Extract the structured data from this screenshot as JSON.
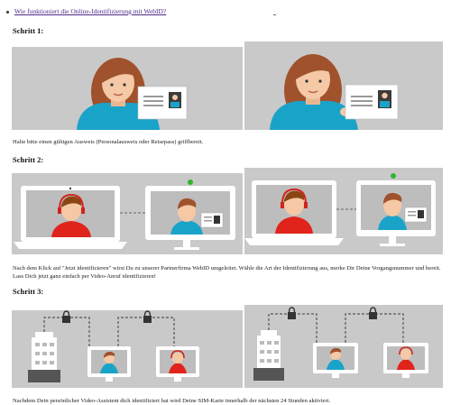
{
  "faq_link": "Wie funktioniert die Online-Identifizierung mit WebID?",
  "steps": [
    {
      "title": "Schritt 1:",
      "caption": "Halte bitte einen gültigen Ausweis (Personalausweis oder Reisepass) griffbereit."
    },
    {
      "title": "Schritt 2:",
      "caption": "Nach dem Klick auf \"Jetzt identifizieren\" wirst Du zu unserer Partnerfirma WebID umgeleitet. Wähle die Art der Identifizierung aus, merke Dir Deine Vorgangsnummer und bereit. Lass Dich jetzt ganz einfach per Video-Anruf identifizieren!"
    },
    {
      "title": "Schritt 3:",
      "caption": "Nachdem Dein persönlicher Video-Assistent dich identifiziert hat wird Deine SIM-Karte innerhalb der nächsten 24 Stunden aktiviert."
    }
  ],
  "colors": {
    "panel_bg": "#c9c9c9",
    "skin": "#f5c9a5",
    "hair": "#a0522d",
    "shirt": "#1aa3c9",
    "agent_shirt": "#e0241c",
    "link": "#4d2b8a"
  }
}
